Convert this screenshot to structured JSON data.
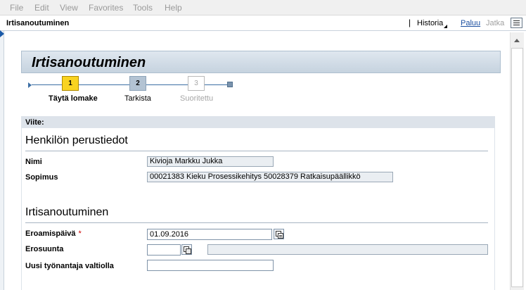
{
  "menu": {
    "items": [
      "File",
      "Edit",
      "View",
      "Favorites",
      "Tools",
      "Help"
    ]
  },
  "titlebar": {
    "title": "Irtisanoutuminen",
    "separator": "|",
    "historia": "Historia",
    "paluu": "Paluu",
    "jatka": "Jatka"
  },
  "main": {
    "title": "Irtisanoutuminen"
  },
  "roadmap": {
    "steps": [
      {
        "number": "1",
        "label": "Täytä lomake",
        "state": "current"
      },
      {
        "number": "2",
        "label": "Tarkista",
        "state": "upcoming"
      },
      {
        "number": "3",
        "label": "Suoritettu",
        "state": "disabled"
      }
    ]
  },
  "form": {
    "viite_label": "Viite:",
    "section1_title": "Henkilön perustiedot",
    "nimi_label": "Nimi",
    "nimi_value": "Kivioja Markku Jukka",
    "sopimus_label": "Sopimus",
    "sopimus_value": "00021383 Kieku Prosessikehitys 50028379 Ratkaisupäällikkö",
    "section2_title": "Irtisanoutuminen",
    "eroamispaiva_label": "Eroamispäivä",
    "required_marker": "*",
    "eroamispaiva_value": "01.09.2016",
    "erosuunta_label": "Erosuunta",
    "erosuunta_value": "",
    "erosuunta_desc": "",
    "uusi_tyonantaja_label": "Uusi työnantaja valtiolla",
    "uusi_tyonantaja_value": ""
  },
  "colors": {
    "current_step": "#f9d321",
    "link": "#1b4fa0",
    "required": "#cc0000",
    "header_band": "#c6d3df"
  }
}
